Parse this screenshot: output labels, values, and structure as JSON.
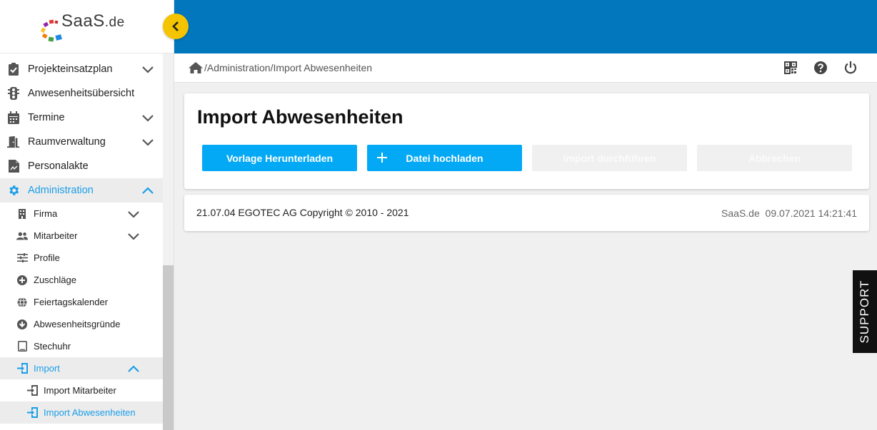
{
  "logo": {
    "name": "SaaS",
    "tld": ".de"
  },
  "sidebar": {
    "items": [
      {
        "label": "Projekteinsatzplan",
        "icon": "clipboard-check-icon"
      },
      {
        "label": "Anwesenheitsübersicht",
        "icon": "traffic-light-icon"
      },
      {
        "label": "Termine",
        "icon": "calendar-icon"
      },
      {
        "label": "Raumverwaltung",
        "icon": "door-icon"
      },
      {
        "label": "Personalakte",
        "icon": "document-icon"
      },
      {
        "label": "Administration",
        "icon": "gear-icon"
      },
      {
        "label": "Firma",
        "icon": "building-icon"
      },
      {
        "label": "Mitarbeiter",
        "icon": "people-icon"
      },
      {
        "label": "Profile",
        "icon": "sliders-icon"
      },
      {
        "label": "Zuschläge",
        "icon": "plus-circle-icon"
      },
      {
        "label": "Feiertagskalender",
        "icon": "globe-icon"
      },
      {
        "label": "Abwesenheitsgründe",
        "icon": "arrow-down-circle-icon"
      },
      {
        "label": "Stechuhr",
        "icon": "tablet-icon"
      },
      {
        "label": "Import",
        "icon": "import-icon"
      },
      {
        "label": "Import Mitarbeiter",
        "icon": "import-icon"
      },
      {
        "label": "Import Abwesenheiten",
        "icon": "import-icon"
      }
    ]
  },
  "breadcrumb": "/Administration/Import Abwesenheiten",
  "page": {
    "title": "Import Abwesenheiten",
    "buttons": {
      "download": "Vorlage Herunterladen",
      "upload": "Datei hochladen",
      "run": "Import durchführen",
      "cancel": "Abbrechen"
    }
  },
  "footer": {
    "copyright": "21.07.04 EGOTEC AG Copyright © 2010 - 2021",
    "brand": "SaaS.de",
    "timestamp": "09.07.2021 14:21:41"
  },
  "support_label": "SUPPORT",
  "colors": {
    "header": "#0277bd",
    "accent": "#1a9ee8",
    "primary_button": "#03a9f4",
    "collapse_button": "#f5c400"
  }
}
